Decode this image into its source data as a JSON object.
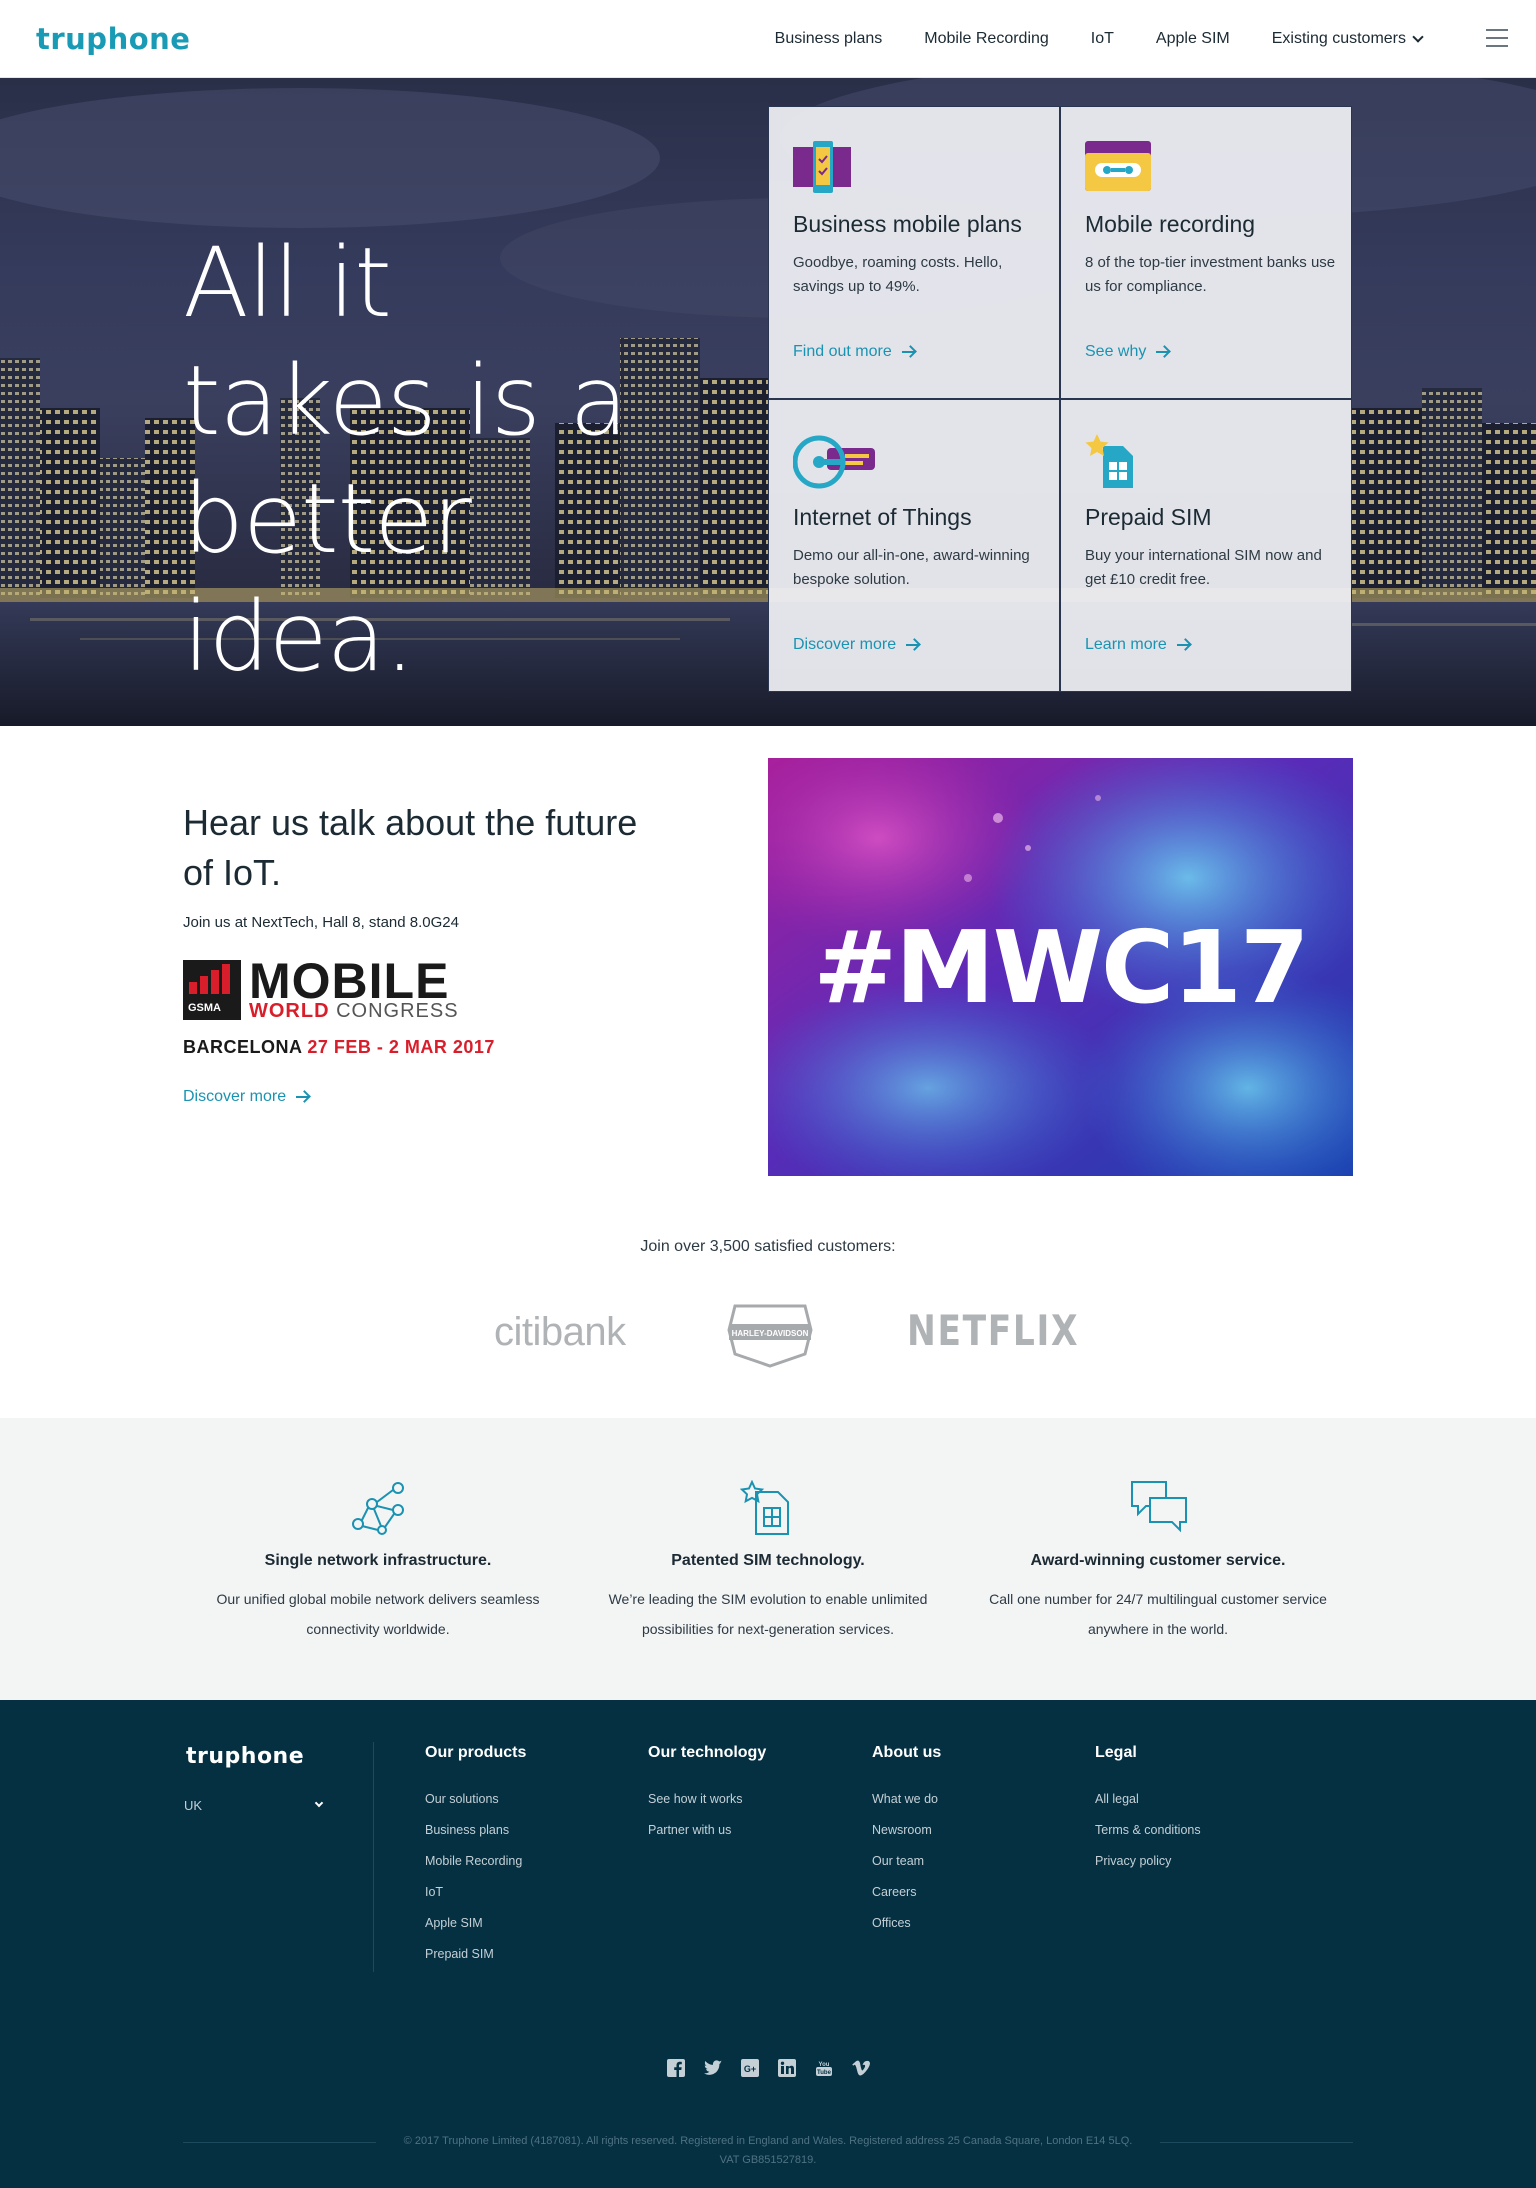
{
  "header": {
    "logo": "truphone",
    "nav": [
      {
        "label": "Business plans"
      },
      {
        "label": "Mobile Recording"
      },
      {
        "label": "IoT"
      },
      {
        "label": "Apple SIM"
      },
      {
        "label": "Existing customers"
      }
    ]
  },
  "hero": {
    "title": "All it takes is a better idea.",
    "cards": [
      {
        "title": "Business mobile plans",
        "desc": "Goodbye, roaming costs. Hello, savings up to 49%.",
        "link": "Find out more",
        "icon": "phone-check-icon"
      },
      {
        "title": "Mobile recording",
        "desc": "8 of the top-tier investment banks use us for compliance.",
        "link": "See why",
        "icon": "cassette-icon"
      },
      {
        "title": "Internet of Things",
        "desc": "Demo our all-in-one, award-winning bespoke solution.",
        "link": "Discover more",
        "icon": "iot-gauge-icon"
      },
      {
        "title": "Prepaid SIM",
        "desc": "Buy your international SIM now and get £10 credit free.",
        "link": "Learn more",
        "icon": "sim-star-icon"
      }
    ]
  },
  "event": {
    "heading": "Hear us talk about the future of IoT.",
    "sub": "Join us at NextTech, Hall 8, stand 8.0G24",
    "logo_gsma": "GSMA",
    "logo_mobile": "MOBILE",
    "logo_world": "WORLD",
    "logo_congress": "CONGRESS",
    "city": "BARCELONA",
    "dates": "27 FEB - 2 MAR 2017",
    "link": "Discover more",
    "image_tag": "#MWC17"
  },
  "customers": {
    "title": "Join over 3,500 satisfied customers:",
    "logos": [
      "citibank",
      "NETFLIX"
    ],
    "harley_text": "HARLEY-DAVIDSON"
  },
  "features": [
    {
      "title": "Single network infrastructure.",
      "desc": "Our unified global mobile network delivers seamless connectivity worldwide.",
      "icon": "network-nodes-icon"
    },
    {
      "title": "Patented SIM technology.",
      "desc": "We’re leading the SIM evolution to enable unlimited possibilities for next-generation services.",
      "icon": "sim-star-icon"
    },
    {
      "title": "Award-winning customer service.",
      "desc": "Call one number for 24/7 multilingual customer service anywhere in the world.",
      "icon": "chat-bubbles-icon"
    }
  ],
  "footer": {
    "logo": "truphone",
    "country": "UK",
    "columns": [
      {
        "heading": "Our products",
        "links": [
          "Our solutions",
          "Business plans",
          "Mobile Recording",
          "IoT",
          "Apple SIM",
          "Prepaid SIM"
        ]
      },
      {
        "heading": "Our technology",
        "links": [
          "See how it works",
          "Partner with us"
        ]
      },
      {
        "heading": "About us",
        "links": [
          "What we do",
          "Newsroom",
          "Our team",
          "Careers",
          "Offices"
        ]
      },
      {
        "heading": "Legal",
        "links": [
          "All legal",
          "Terms & conditions",
          "Privacy policy"
        ]
      }
    ],
    "social": [
      "facebook-icon",
      "twitter-icon",
      "google-plus-icon",
      "linkedin-icon",
      "youtube-icon",
      "vimeo-icon"
    ],
    "copyright": "© 2017 Truphone Limited (4187081). All rights reserved. Registered in England and Wales. Registered address 25 Canada Square, London E14 5LQ. VAT GB851527819."
  },
  "colors": {
    "accent": "#1a93b2",
    "footer_bg": "#053042",
    "mwc_red": "#d81e2a",
    "purple_icon": "#7a2a8c"
  }
}
